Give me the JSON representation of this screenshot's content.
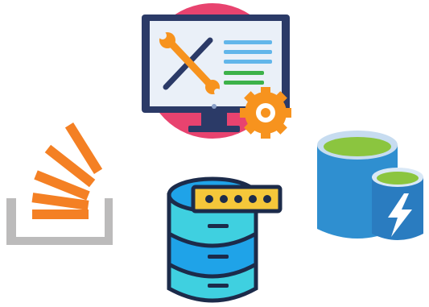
{
  "icons": [
    {
      "name": "monitor-tools-gear-icon",
      "colors": {
        "screen": "#2b3a67",
        "circle": "#e8436f",
        "gear": "#f7931e",
        "tools": "#f7931e"
      }
    },
    {
      "name": "stack-overflow-icon",
      "colors": {
        "bars": "#f48024",
        "tray": "#bcbbbb"
      }
    },
    {
      "name": "database-password-icon",
      "colors": {
        "outline": "#1c2b4a",
        "cylinder": "#1fa3e8",
        "mid": "#3fd0e0",
        "key": "#f5c73a"
      }
    },
    {
      "name": "azure-cache-lightning-icon",
      "colors": {
        "cyl": "#2f8fd0",
        "top": "#8bc53f",
        "bolt": "#ffffff"
      }
    }
  ]
}
